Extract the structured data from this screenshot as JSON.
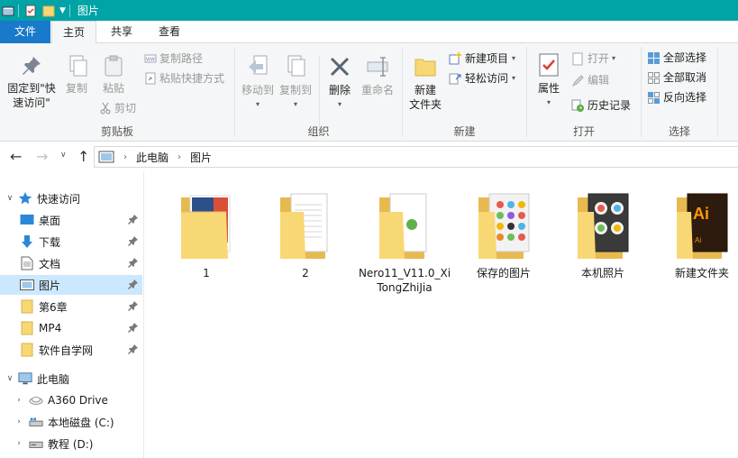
{
  "window": {
    "title": "图片"
  },
  "tabs": {
    "file": "文件",
    "home": "主页",
    "share": "共享",
    "view": "查看"
  },
  "ribbon": {
    "clipboard": {
      "label": "剪贴板",
      "pin_quick": "固定到\"快速访问\"",
      "copy": "复制",
      "paste": "粘贴",
      "copy_path": "复制路径",
      "paste_shortcut": "粘贴快捷方式",
      "cut": "剪切"
    },
    "organize": {
      "label": "组织",
      "move_to": "移动到",
      "copy_to": "复制到",
      "delete": "删除",
      "rename": "重命名"
    },
    "new": {
      "label": "新建",
      "new_folder": "新建\n文件夹",
      "new_item": "新建项目",
      "easy_access": "轻松访问"
    },
    "open": {
      "label": "打开",
      "properties": "属性",
      "open": "打开",
      "edit": "编辑",
      "history": "历史记录"
    },
    "select": {
      "label": "选择",
      "select_all": "全部选择",
      "select_none": "全部取消",
      "invert": "反向选择"
    }
  },
  "address": {
    "segments": [
      "此电脑",
      "图片"
    ]
  },
  "navpane": {
    "quick_access": "快速访问",
    "quick_items": [
      "桌面",
      "下载",
      "文档",
      "图片",
      "第6章",
      "MP4",
      "软件自学网"
    ],
    "this_pc": "此电脑",
    "drives": [
      "A360 Drive",
      "本地磁盘 (C:)",
      "教程 (D:)"
    ]
  },
  "folders": [
    {
      "name": "1",
      "thumb": "photo"
    },
    {
      "name": "2",
      "thumb": "doc"
    },
    {
      "name": "Nero11_V11.0_XiTongZhiJia",
      "thumb": "nero"
    },
    {
      "name": "保存的图片",
      "thumb": "icons"
    },
    {
      "name": "本机照片",
      "thumb": "photos"
    },
    {
      "name": "新建文件夹",
      "thumb": "ai"
    }
  ],
  "colors": {
    "titlebar": "#00a3a6",
    "file_tab": "#1979ca",
    "selected": "#cce8ff",
    "folder": "#f8d775"
  }
}
